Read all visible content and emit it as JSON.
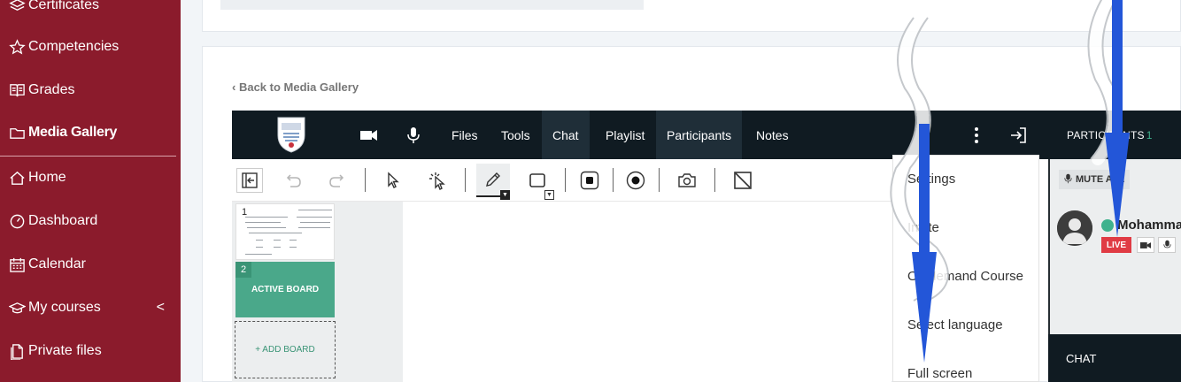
{
  "sidebar": {
    "items": [
      {
        "label": "Certificates",
        "icon": "layers-icon"
      },
      {
        "label": "Competencies",
        "icon": "star-icon"
      },
      {
        "label": "Grades",
        "icon": "book-icon"
      },
      {
        "label": "Media Gallery",
        "icon": "folder-icon",
        "active": true
      },
      {
        "label": "Home",
        "icon": "home-icon"
      },
      {
        "label": "Dashboard",
        "icon": "gauge-icon"
      },
      {
        "label": "Calendar",
        "icon": "calendar-icon"
      },
      {
        "label": "My courses",
        "icon": "graduation-cap-icon",
        "chevron": "<"
      },
      {
        "label": "Private files",
        "icon": "file-icon"
      }
    ],
    "bg_color": "#8b1b2c"
  },
  "back_link": "Back to Media Gallery",
  "bbb": {
    "tabs": [
      "Files",
      "Tools",
      "Chat",
      "Playlist",
      "Participants",
      "Notes"
    ],
    "participants_header": "PARTICIPANTS",
    "participants_count": "1",
    "bar_color": "#101b22"
  },
  "boards": {
    "thumb1_number": "1",
    "thumb2_number": "2",
    "active_label": "ACTIVE BOARD",
    "add_label": "+ ADD BOARD",
    "accent": "#4aa88a"
  },
  "menu": {
    "items": [
      "Settings",
      "Invite",
      "On demand Course",
      "Select language",
      "Full screen"
    ]
  },
  "participant": {
    "mute_all": "MUTE ALL",
    "name": "Mohammad",
    "live": "LIVE"
  },
  "chat_label": "CHAT"
}
